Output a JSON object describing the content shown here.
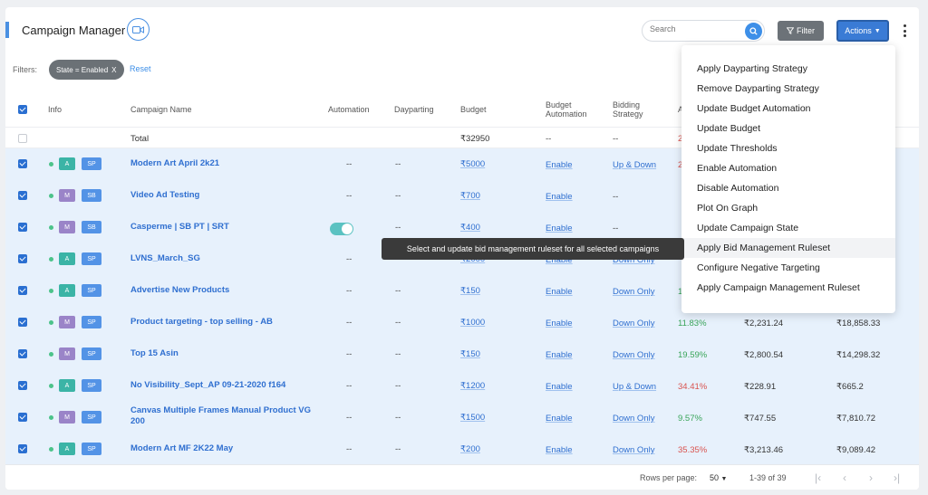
{
  "header": {
    "title": "Campaign Manager",
    "search_placeholder": "Search",
    "filter_label": "Filter",
    "actions_label": "Actions"
  },
  "filters": {
    "label": "Filters:",
    "chip": "State = Enabled",
    "chip_close": "X",
    "reset": "Reset"
  },
  "columns": {
    "info": "Info",
    "campaign_name": "Campaign Name",
    "automation": "Automation",
    "dayparting": "Dayparting",
    "budget": "Budget",
    "budget_automation_1": "Budget",
    "budget_automation_2": "Automation",
    "bidding_strategy_1": "Bidding",
    "bidding_strategy_2": "Strategy",
    "partial": "A"
  },
  "total_row": {
    "label": "Total",
    "automation": "",
    "dayparting": "",
    "budget": "₹32950",
    "budget_automation": "--",
    "bidding": "--",
    "partial": "2"
  },
  "rows": [
    {
      "selected": true,
      "tag1": "A",
      "tag2": "SP",
      "name": "Modern Art April 2k21",
      "automation": "--",
      "dayparting": "--",
      "budget": "₹5000",
      "budget_automation": "Enable",
      "bidding": "Up & Down",
      "metric": "2",
      "metric_color": "red",
      "value1": "",
      "value2": ""
    },
    {
      "selected": true,
      "tag1": "M",
      "tag2": "SB",
      "name": "Video Ad Testing",
      "automation": "--",
      "dayparting": "--",
      "budget": "₹700",
      "budget_automation": "Enable",
      "bidding": "--",
      "metric": "",
      "metric_color": "",
      "value1": "",
      "value2": ""
    },
    {
      "selected": true,
      "tag1": "M",
      "tag2": "SB",
      "name": "Casperme | SB PT | SRT",
      "automation": "toggle",
      "dayparting": "--",
      "budget": "₹400",
      "budget_automation": "Enable",
      "bidding": "--",
      "metric": "",
      "metric_color": "",
      "value1": "",
      "value2": ""
    },
    {
      "selected": true,
      "tag1": "A",
      "tag2": "SP",
      "name": "LVNS_March_SG",
      "automation": "--",
      "dayparting": "--",
      "budget": "₹2000",
      "budget_automation": "Enable",
      "bidding": "Down Only",
      "metric": "",
      "metric_color": "",
      "value1": "",
      "value2": ""
    },
    {
      "selected": true,
      "tag1": "A",
      "tag2": "SP",
      "name": "Advertise New Products",
      "automation": "--",
      "dayparting": "--",
      "budget": "₹150",
      "budget_automation": "Enable",
      "bidding": "Down Only",
      "metric": "1",
      "metric_color": "green",
      "value1": "",
      "value2": ""
    },
    {
      "selected": true,
      "tag1": "M",
      "tag2": "SP",
      "name": "Product targeting - top selling - AB",
      "automation": "--",
      "dayparting": "--",
      "budget": "₹1000",
      "budget_automation": "Enable",
      "bidding": "Down Only",
      "metric": "11.83%",
      "metric_color": "green",
      "value1": "₹2,231.24",
      "value2": "₹18,858.33"
    },
    {
      "selected": true,
      "tag1": "M",
      "tag2": "SP",
      "name": "Top 15 Asin",
      "automation": "--",
      "dayparting": "--",
      "budget": "₹150",
      "budget_automation": "Enable",
      "bidding": "Down Only",
      "metric": "19.59%",
      "metric_color": "green",
      "value1": "₹2,800.54",
      "value2": "₹14,298.32"
    },
    {
      "selected": true,
      "tag1": "A",
      "tag2": "SP",
      "name": "No Visibility_Sept_AP 09-21-2020 f164",
      "automation": "--",
      "dayparting": "--",
      "budget": "₹1200",
      "budget_automation": "Enable",
      "bidding": "Up & Down",
      "metric": "34.41%",
      "metric_color": "red",
      "value1": "₹228.91",
      "value2": "₹665.2"
    },
    {
      "selected": true,
      "tag1": "M",
      "tag2": "SP",
      "name": "Canvas Multiple Frames Manual Product VG 200",
      "automation": "--",
      "dayparting": "--",
      "budget": "₹1500",
      "budget_automation": "Enable",
      "bidding": "Down Only",
      "metric": "9.57%",
      "metric_color": "green",
      "value1": "₹747.55",
      "value2": "₹7,810.72"
    },
    {
      "selected": true,
      "tag1": "A",
      "tag2": "SP",
      "name": "Modern Art MF 2K22 May",
      "automation": "--",
      "dayparting": "--",
      "budget": "₹200",
      "budget_automation": "Enable",
      "bidding": "Down Only",
      "metric": "35.35%",
      "metric_color": "red",
      "value1": "₹3,213.46",
      "value2": "₹9,089.42"
    }
  ],
  "tooltip": "Select and update bid management ruleset for all selected campaigns",
  "menu": [
    "Apply Dayparting Strategy",
    "Remove Dayparting Strategy",
    "Update Budget Automation",
    "Update Budget",
    "Update Thresholds",
    "Enable Automation",
    "Disable Automation",
    "Plot On Graph",
    "Update Campaign State",
    "Apply Bid Management Ruleset",
    "Configure Negative Targeting",
    "Apply Campaign Management Ruleset"
  ],
  "menu_highlighted": "Apply Bid Management Ruleset",
  "footer": {
    "rows_per_page_label": "Rows per page:",
    "rows_per_page_value": "50",
    "range": "1-39 of 39"
  },
  "colors": {
    "accent": "#3a7bd5",
    "selected_row": "#e7f1fc",
    "positive": "#3aa55a",
    "negative": "#d9534f"
  }
}
